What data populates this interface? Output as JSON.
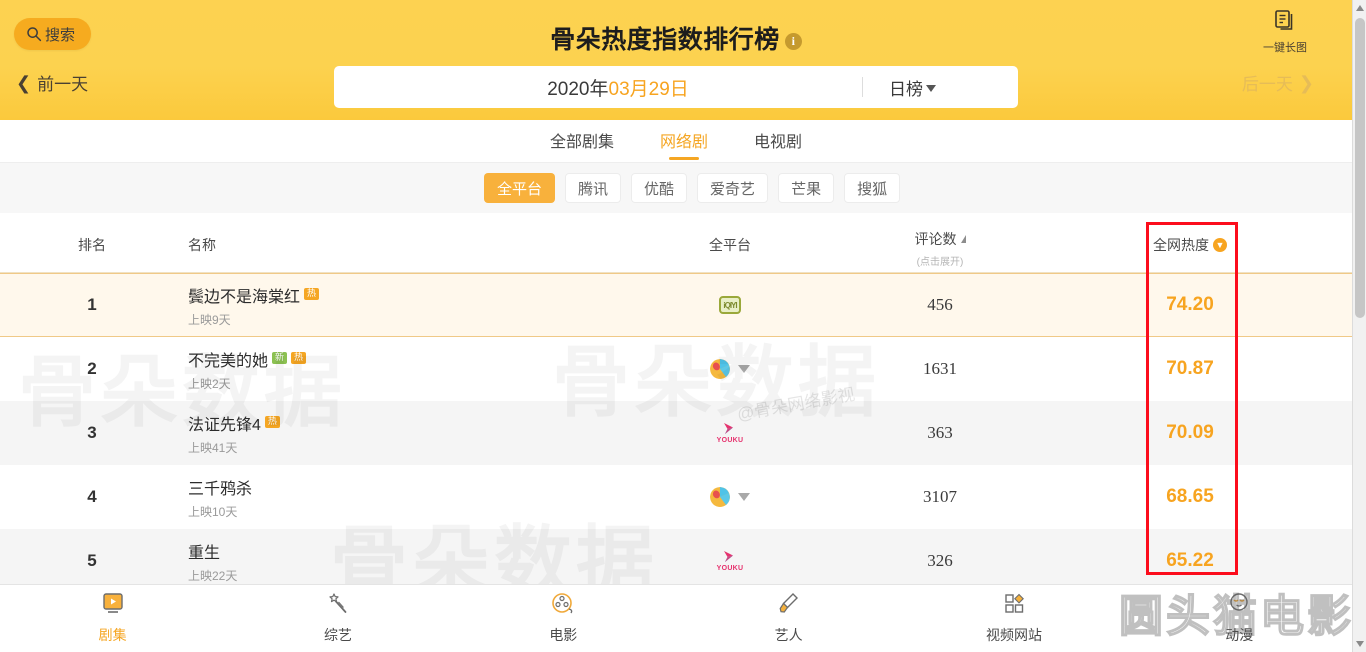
{
  "header": {
    "search_label": "搜索",
    "title": "骨朵热度指数排行榜",
    "info_badge": "i",
    "longpic_label": "一键长图",
    "prev_day": "前一天",
    "next_day": "后一天",
    "date": {
      "year": "2020年",
      "month": "03月",
      "day": "29日",
      "full": "2020年03月29日"
    },
    "rank_type": "日榜"
  },
  "category_tabs": [
    {
      "label": "全部剧集",
      "active": false
    },
    {
      "label": "网络剧",
      "active": true
    },
    {
      "label": "电视剧",
      "active": false
    }
  ],
  "platform_filters": [
    {
      "label": "全平台",
      "active": true
    },
    {
      "label": "腾讯",
      "active": false
    },
    {
      "label": "优酷",
      "active": false
    },
    {
      "label": "爱奇艺",
      "active": false
    },
    {
      "label": "芒果",
      "active": false
    },
    {
      "label": "搜狐",
      "active": false
    }
  ],
  "table": {
    "columns": {
      "rank": "排名",
      "name": "名称",
      "platform": "全平台",
      "comments": "评论数",
      "comments_sub": "(点击展开)",
      "heat": "全网热度"
    },
    "rows": [
      {
        "rank": "1",
        "name": "鬓边不是海棠红",
        "tags": [
          "热"
        ],
        "sub": "上映9天",
        "platform": "iqiyi",
        "more": false,
        "comments": "456",
        "heat": "74.20"
      },
      {
        "rank": "2",
        "name": "不完美的她",
        "tags": [
          "新",
          "热"
        ],
        "sub": "上映2天",
        "platform": "mango",
        "more": true,
        "comments": "1631",
        "heat": "70.87"
      },
      {
        "rank": "3",
        "name": "法证先锋4",
        "tags": [
          "热"
        ],
        "sub": "上映41天",
        "platform": "youku",
        "more": false,
        "comments": "363",
        "heat": "70.09"
      },
      {
        "rank": "4",
        "name": "三千鸦杀",
        "tags": [],
        "sub": "上映10天",
        "platform": "mango",
        "more": true,
        "comments": "3107",
        "heat": "68.65"
      },
      {
        "rank": "5",
        "name": "重生",
        "tags": [],
        "sub": "上映22天",
        "platform": "youku",
        "more": false,
        "comments": "326",
        "heat": "65.22"
      }
    ]
  },
  "watermarks": {
    "big_left": "骨朵数据",
    "big_right": "骨朵数据",
    "attribution": "@骨朵网络影视",
    "corner": "圆头猫电影"
  },
  "bottom_nav": [
    {
      "label": "剧集",
      "icon": "play-box-icon",
      "active": true
    },
    {
      "label": "综艺",
      "icon": "magic-wand-icon",
      "active": false
    },
    {
      "label": "电影",
      "icon": "film-reel-icon",
      "active": false
    },
    {
      "label": "艺人",
      "icon": "paintbrush-icon",
      "active": false
    },
    {
      "label": "视频网站",
      "icon": "grid-squares-icon",
      "active": false
    },
    {
      "label": "动漫",
      "icon": "anime-icon",
      "active": false
    }
  ],
  "colors": {
    "brand_yellow": "#fcd24f",
    "accent_orange": "#f7a420",
    "highlight_red": "#fc0d1c",
    "tag_hot": "#f5a623",
    "tag_new": "#8cc152"
  }
}
